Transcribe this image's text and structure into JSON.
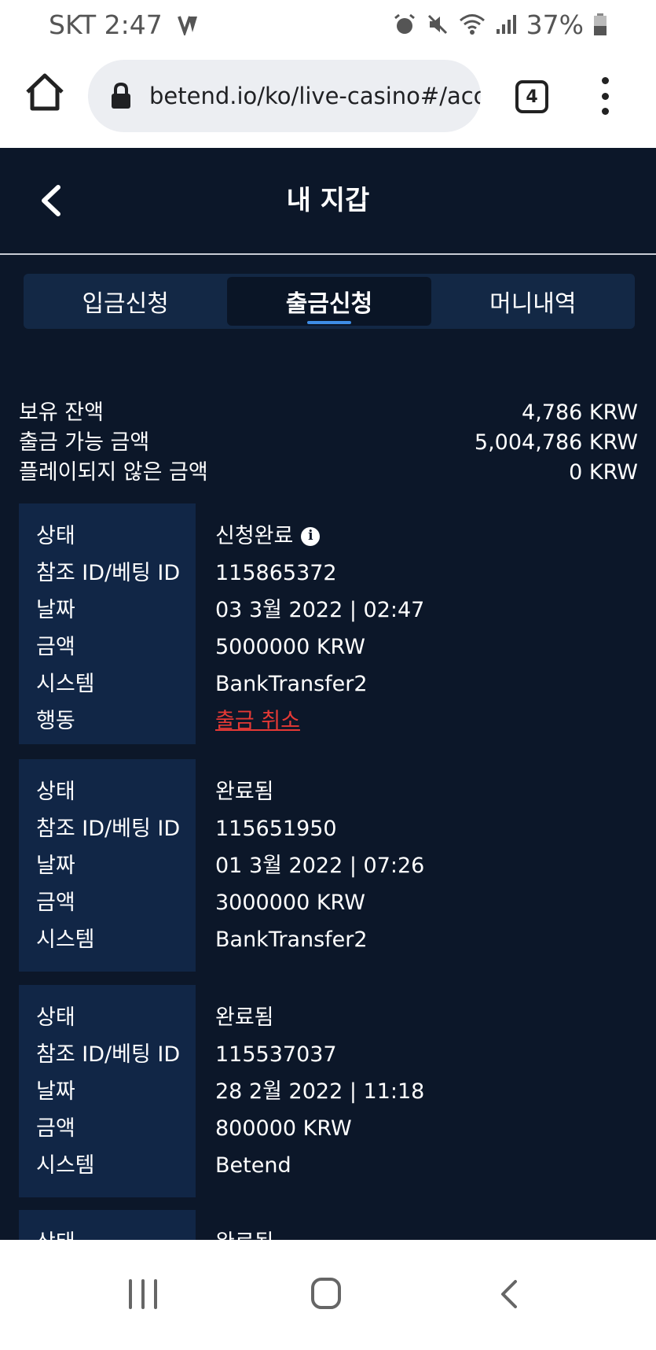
{
  "status_bar": {
    "carrier_time": "SKT 2:47",
    "battery": "37%",
    "icons": [
      "vpn-icon",
      "alarm-icon",
      "mute-icon",
      "wifi-icon",
      "signal-icon",
      "battery-icon"
    ]
  },
  "browser": {
    "url": "betend.io/ko/live-casino#/acco",
    "tab_count": "4"
  },
  "header": {
    "title": "내 지갑"
  },
  "tabs": [
    {
      "label": "입금신청"
    },
    {
      "label": "출금신청"
    },
    {
      "label": "머니내역"
    }
  ],
  "active_tab": 1,
  "summary": [
    {
      "label": "보유 잔액",
      "value": "4,786 KRW"
    },
    {
      "label": "출금 가능 금액",
      "value": "5,004,786 KRW"
    },
    {
      "label": "플레이되지 않은 금액",
      "value": "0 KRW"
    }
  ],
  "records": [
    {
      "rows": [
        {
          "label": "상태",
          "value": "신청완료"
        },
        {
          "label": "참조 ID/베팅 ID",
          "value": "115865372"
        },
        {
          "label": "날짜",
          "value": "03 3월 2022 | 02:47"
        },
        {
          "label": "금액",
          "value": "5000000 KRW"
        },
        {
          "label": "시스템",
          "value": "BankTransfer2"
        },
        {
          "label": "행동",
          "value": "출금 취소"
        }
      ]
    },
    {
      "rows": [
        {
          "label": "상태",
          "value": "완료됨"
        },
        {
          "label": "참조 ID/베팅 ID",
          "value": "115651950"
        },
        {
          "label": "날짜",
          "value": "01 3월 2022 | 07:26"
        },
        {
          "label": "금액",
          "value": "3000000 KRW"
        },
        {
          "label": "시스템",
          "value": "BankTransfer2"
        }
      ]
    },
    {
      "rows": [
        {
          "label": "상태",
          "value": "완료됨"
        },
        {
          "label": "참조 ID/베팅 ID",
          "value": "115537037"
        },
        {
          "label": "날짜",
          "value": "28 2월 2022 | 11:18"
        },
        {
          "label": "금액",
          "value": "800000 KRW"
        },
        {
          "label": "시스템",
          "value": "Betend"
        }
      ]
    },
    {
      "rows": [
        {
          "label": "상태",
          "value": "완료됨"
        }
      ]
    }
  ],
  "colors": {
    "page_bg": "#0c1729",
    "card_label_bg": "#112646",
    "tab_bar_bg": "#132845",
    "active_tab_underline": "#3e8de6",
    "cancel_link": "#e53935"
  }
}
